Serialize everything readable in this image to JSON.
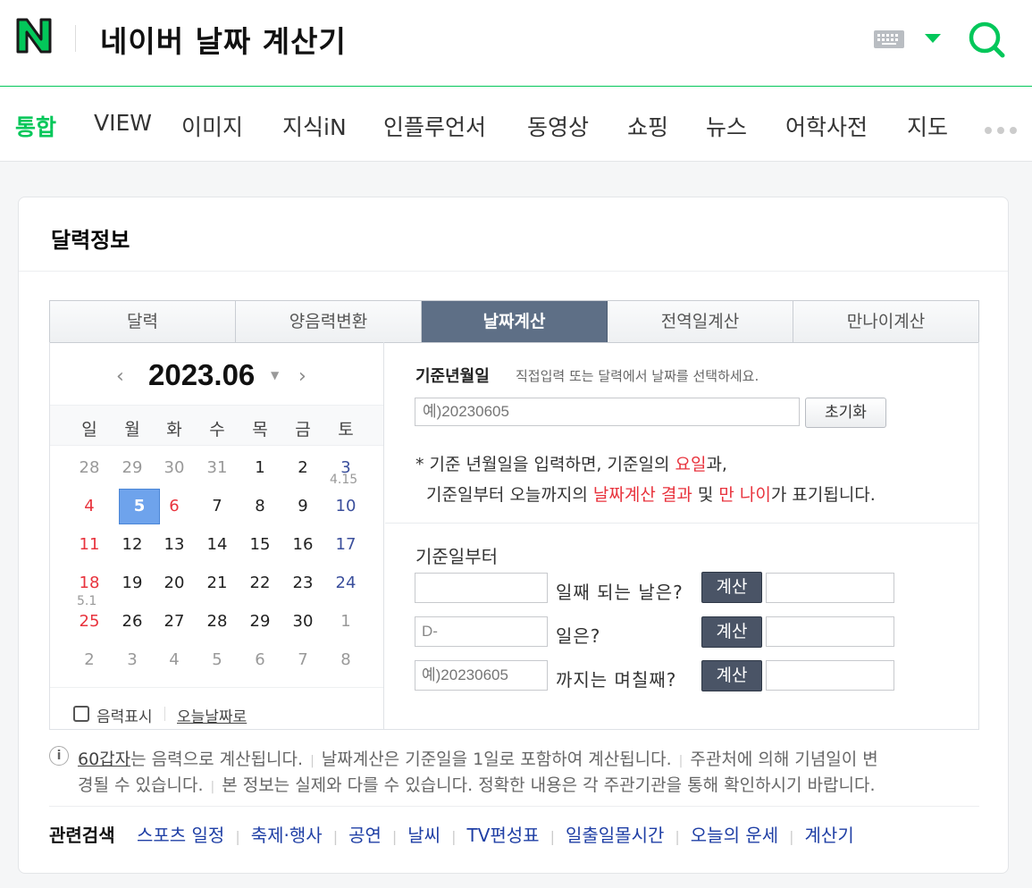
{
  "header": {
    "logo_letter": "N",
    "query": "네이버 날짜 계산기",
    "keyboard_icon": "keyboard-icon",
    "dropdown_icon": "caret-down-icon",
    "search_icon": "search-icon"
  },
  "tabs": [
    "통합",
    "VIEW",
    "이미지",
    "지식iN",
    "인플루언서",
    "동영상",
    "쇼핑",
    "뉴스",
    "어학사전",
    "지도"
  ],
  "card": {
    "title": "달력정보",
    "subtabs": [
      "달력",
      "양음력변환",
      "날짜계산",
      "전역일계산",
      "만나이계산"
    ],
    "active_subtab": "날짜계산"
  },
  "calendar": {
    "month": "2023.06",
    "weekdays": [
      "일",
      "월",
      "화",
      "수",
      "목",
      "금",
      "토"
    ],
    "weeks": [
      [
        "28",
        "29",
        "30",
        "31",
        "1",
        "2",
        "3"
      ],
      [
        "4",
        "5",
        "6",
        "7",
        "8",
        "9",
        "10"
      ],
      [
        "11",
        "12",
        "13",
        "14",
        "15",
        "16",
        "17"
      ],
      [
        "18",
        "19",
        "20",
        "21",
        "22",
        "23",
        "24"
      ],
      [
        "25",
        "26",
        "27",
        "28",
        "29",
        "30",
        "1"
      ],
      [
        "2",
        "3",
        "4",
        "5",
        "6",
        "7",
        "8"
      ]
    ],
    "lunar_notes": {
      "w0_sat": "4.15",
      "w3_sun": "5.1"
    },
    "selected_day": "5",
    "lunar_label": "음력표시",
    "today_link": "오늘날짜로"
  },
  "form": {
    "base_label": "기준년월일",
    "base_hint": "직접입력 또는 달력에서 날짜를 선택하세요.",
    "base_placeholder": "예)20230605",
    "reset_label": "초기화",
    "note_line1_a": "* 기준 년월일을 입력하면, 기준일의 ",
    "note_line1_red": "요일",
    "note_line1_b": "과,",
    "note_line2_a": "기준일부터 오늘까지의 ",
    "note_line2_red1": "날짜계산 결과",
    "note_line2_b": " 및 ",
    "note_line2_red2": "만 나이",
    "note_line2_c": "가 표기됩니다.",
    "from_label": "기준일부터",
    "row1_question": "일째 되는 날은?",
    "row2_value": "D-",
    "row2_question": "일은?",
    "row3_placeholder": "예)20230605",
    "row3_question": "까지는 며칠째?",
    "calc_label": "계산"
  },
  "info": {
    "line1_link": "60갑자",
    "line1_a": "는 음력으로 계산됩니다.",
    "line1_b": "날짜계산은 기준일을 1일로 포함하여 계산됩니다.",
    "line1_c": "주관처에 의해 기념일이 변",
    "line2_a": "경될 수 있습니다.",
    "line2_b": "본 정보는 실제와 다를 수 있습니다. 정확한 내용은 각 주관기관을 통해 확인하시기 바랍니다."
  },
  "related": {
    "title": "관련검색",
    "items": [
      "스포츠 일정",
      "축제·행사",
      "공연",
      "날씨",
      "TV편성표",
      "일출일몰시간",
      "오늘의 운세",
      "계산기"
    ]
  },
  "colors": {
    "brand": "#03c75a",
    "active_subtab": "#5e6f86",
    "sunday": "#e8333d",
    "saturday": "#3b4f9c",
    "link": "#1f3fa5"
  }
}
